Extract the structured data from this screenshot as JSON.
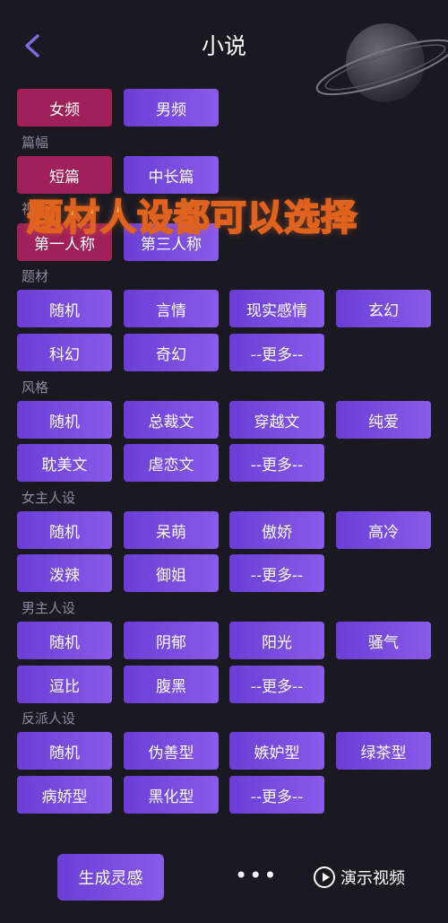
{
  "header": {
    "title": "小说"
  },
  "overlay_text": "题材人设都可以选择",
  "gender": {
    "items": [
      "女频",
      "男频"
    ],
    "selected": "女频"
  },
  "pian": {
    "label": "篇幅",
    "items": [
      "短篇",
      "中长篇"
    ],
    "selected": "短篇"
  },
  "view": {
    "label": "视角",
    "items": [
      "第一人称",
      "第三人称"
    ],
    "selected": "第一人称"
  },
  "theme": {
    "label": "题材",
    "items": [
      "随机",
      "言情",
      "现实感情",
      "玄幻",
      "科幻",
      "奇幻",
      "--更多--"
    ]
  },
  "style": {
    "label": "风格",
    "items": [
      "随机",
      "总裁文",
      "穿越文",
      "纯爱",
      "耽美文",
      "虐恋文",
      "--更多--"
    ]
  },
  "female": {
    "label": "女主人设",
    "items": [
      "随机",
      "呆萌",
      "傲娇",
      "高冷",
      "泼辣",
      "御姐",
      "--更多--"
    ]
  },
  "male": {
    "label": "男主人设",
    "items": [
      "随机",
      "阴郁",
      "阳光",
      "骚气",
      "逗比",
      "腹黑",
      "--更多--"
    ]
  },
  "villain": {
    "label": "反派人设",
    "items": [
      "随机",
      "伪善型",
      "嫉妒型",
      "绿茶型",
      "病娇型",
      "黑化型",
      "--更多--"
    ]
  },
  "bottom": {
    "generate_label": "生成灵感",
    "more_label": "•••",
    "demo_label": "演示视频"
  }
}
